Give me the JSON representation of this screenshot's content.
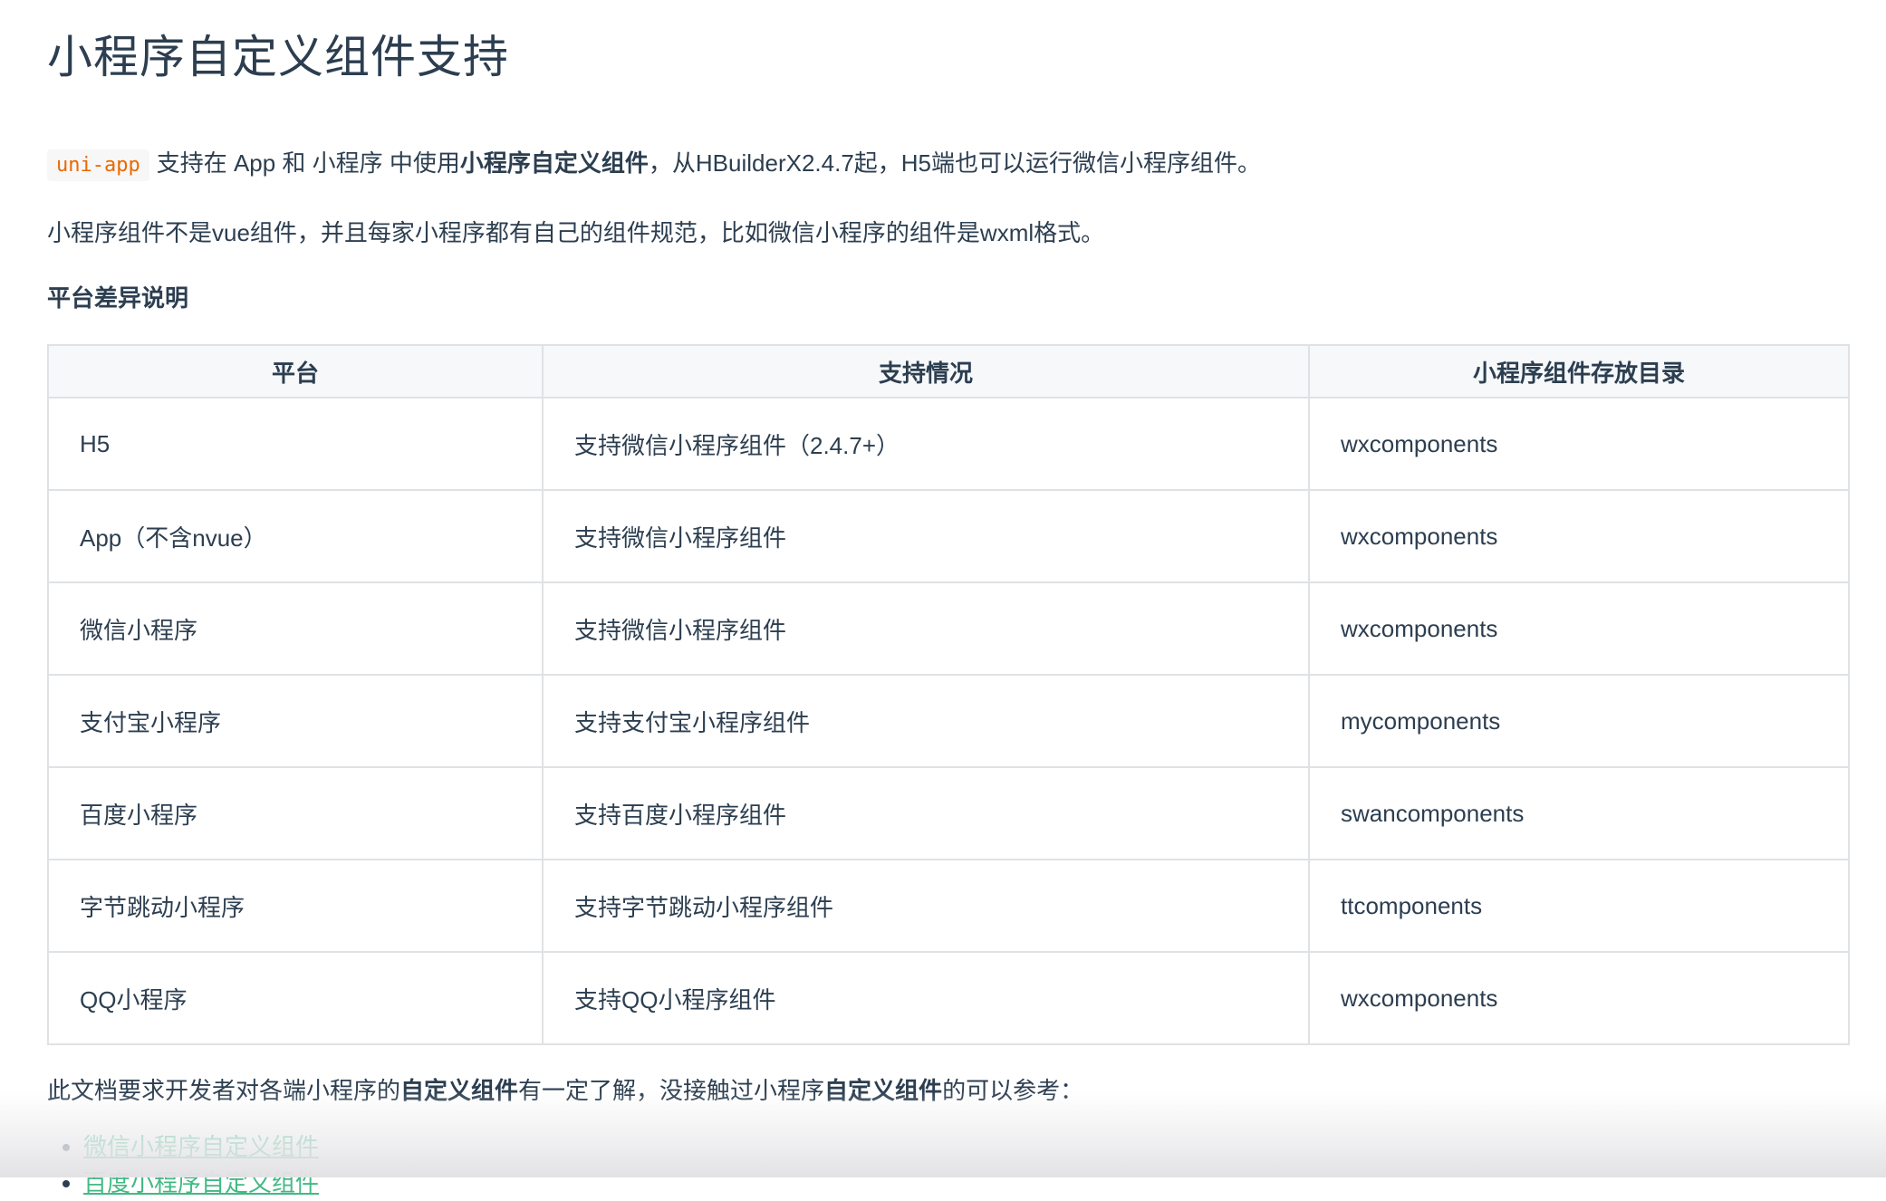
{
  "title": "小程序自定义组件支持",
  "intro": {
    "code": "uni-app",
    "text_before": "支持在 App 和 小程序 中使用",
    "bold": "小程序自定义组件",
    "text_after": "，从HBuilderX2.4.7起，H5端也可以运行微信小程序组件。"
  },
  "note": "小程序组件不是vue组件，并且每家小程序都有自己的组件规范，比如微信小程序的组件是wxml格式。",
  "section_title": "平台差异说明",
  "table": {
    "headers": [
      "平台",
      "支持情况",
      "小程序组件存放目录"
    ],
    "rows": [
      [
        "H5",
        "支持微信小程序组件（2.4.7+）",
        "wxcomponents"
      ],
      [
        "App（不含nvue）",
        "支持微信小程序组件",
        "wxcomponents"
      ],
      [
        "微信小程序",
        "支持微信小程序组件",
        "wxcomponents"
      ],
      [
        "支付宝小程序",
        "支持支付宝小程序组件",
        "mycomponents"
      ],
      [
        "百度小程序",
        "支持百度小程序组件",
        "swancomponents"
      ],
      [
        "字节跳动小程序",
        "支持字节跳动小程序组件",
        "ttcomponents"
      ],
      [
        "QQ小程序",
        "支持QQ小程序组件",
        "wxcomponents"
      ]
    ]
  },
  "tail": {
    "part1": "此文档要求开发者对各端小程序的",
    "bold1": "自定义组件",
    "part2": "有一定了解，没接触过小程序",
    "bold2": "自定义组件",
    "part3": "的可以参考："
  },
  "links": [
    "微信小程序自定义组件",
    "百度小程序自定义组件"
  ]
}
